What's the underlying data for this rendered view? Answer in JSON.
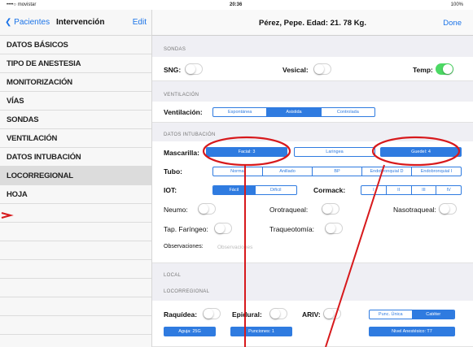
{
  "status": {
    "carrier": "••••○ movistar",
    "time": "20:36",
    "battery": "100%"
  },
  "sidebar": {
    "back_label": "Pacientes",
    "title": "Intervención",
    "edit_label": "Edit",
    "items": [
      "DATOS BÁSICOS",
      "TIPO DE ANESTESIA",
      "MONITORIZACIÓN",
      "VÍAS",
      "SONDAS",
      "VENTILACIÓN",
      "DATOS INTUBACIÓN",
      "LOCORREGIONAL",
      "HOJA"
    ],
    "selected_index": 7
  },
  "header": {
    "title": "Pérez, Pepe. Edad: 21. 78 Kg.",
    "done_label": "Done"
  },
  "sondas": {
    "section": "SONDAS",
    "sng": "SNG:",
    "vesical": "Vesical:",
    "temp": "Temp:",
    "temp_on": true
  },
  "ventilacion": {
    "section": "VENTILACIÓN",
    "label": "Ventilación:",
    "options": [
      "Espontánea",
      "Asistida",
      "Controlada"
    ],
    "selected": 1
  },
  "intubacion": {
    "section": "DATOS INTUBACIÓN",
    "mascarilla": "Mascarilla:",
    "mascarilla_opts": [
      "Facial: 3",
      "Laringea",
      "Guedel: 4"
    ],
    "tubo": "Tubo:",
    "tubo_opts": [
      "Normal",
      "Anillado",
      "BP",
      "Endobronquial D",
      "Endobronquial I"
    ],
    "iot": "IOT:",
    "iot_opts": [
      "Fácil",
      "Difícil"
    ],
    "cormack": "Cormack:",
    "cormack_opts": [
      "I",
      "II",
      "III",
      "IV"
    ],
    "neumo": "Neumo:",
    "orotraqueal": "Orotraqueal:",
    "nasotraqueal": "Nasotraqueal:",
    "tap": "Tap. Faríngeo:",
    "traqueotomia": "Traqueotomía:",
    "observaciones": "Observaciones:",
    "obs_placeholder": "Observaciones"
  },
  "local": {
    "section": "LOCAL"
  },
  "locorregional": {
    "section": "LOCORREGIONAL",
    "raquidea": "Raquídea:",
    "epidural": "Epidural:",
    "arv": "ARIV:",
    "punc_opts": [
      "Punc. Única",
      "Catéter"
    ],
    "aguja": "Aguja: 25G",
    "punciones": "Punciones: 1",
    "nivel": "Nivel Anestésico: T7"
  },
  "colors": {
    "accent": "#2f7be0",
    "annotation": "#d7191c",
    "toggle_on": "#4cd964"
  }
}
